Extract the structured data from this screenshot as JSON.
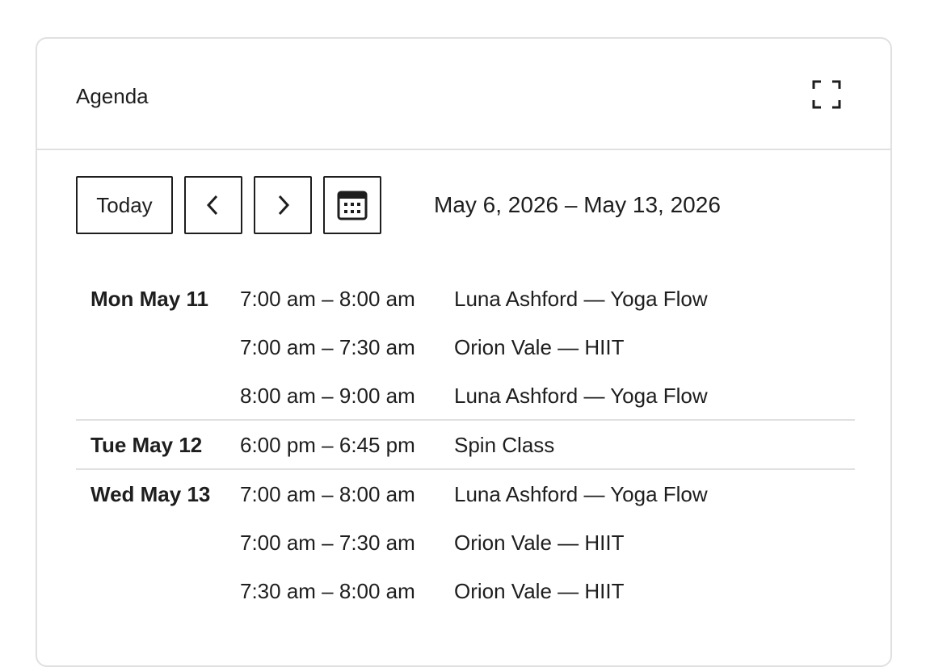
{
  "header": {
    "title": "Agenda",
    "fullscreen_icon": "fullscreen-icon"
  },
  "toolbar": {
    "today_label": "Today",
    "prev_icon": "chevron-left-icon",
    "next_icon": "chevron-right-icon",
    "calendar_icon": "calendar-icon",
    "range": "May 6, 2026 – May 13, 2026"
  },
  "days": [
    {
      "label": "Mon May 11",
      "events": [
        {
          "time": "7:00 am – 8:00 am",
          "title": "Luna Ashford — Yoga Flow"
        },
        {
          "time": "7:00 am – 7:30 am",
          "title": "Orion Vale — HIIT"
        },
        {
          "time": "8:00 am – 9:00 am",
          "title": "Luna Ashford — Yoga Flow"
        }
      ]
    },
    {
      "label": "Tue May 12",
      "events": [
        {
          "time": "6:00 pm – 6:45 pm",
          "title": "Spin Class"
        }
      ]
    },
    {
      "label": "Wed May 13",
      "events": [
        {
          "time": "7:00 am – 8:00 am",
          "title": "Luna Ashford — Yoga Flow"
        },
        {
          "time": "7:00 am – 7:30 am",
          "title": "Orion Vale — HIIT"
        },
        {
          "time": "7:30 am – 8:00 am",
          "title": "Orion Vale — HIIT"
        }
      ]
    }
  ]
}
